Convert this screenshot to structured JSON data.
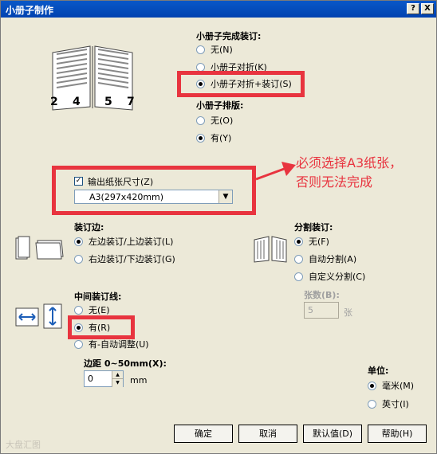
{
  "window": {
    "title": "小册子制作",
    "help_button": "?",
    "close_button": "X"
  },
  "finish": {
    "heading": "小册子完成装订:",
    "options": [
      "无(N)",
      "小册子对折(K)",
      "小册子对折+装订(S)"
    ],
    "selected": 2
  },
  "layout": {
    "heading": "小册子排版:",
    "options": [
      "无(O)",
      "有(Y)"
    ],
    "selected": 1
  },
  "booklet_preview": {
    "pages": [
      "2",
      "4",
      "5",
      "7"
    ]
  },
  "annotation": {
    "line1": "必须选择A3纸张，",
    "line2": "否则无法完成"
  },
  "output_paper": {
    "checkbox_label": "输出纸张尺寸(Z)",
    "checked": true,
    "value": "A3(297x420mm)"
  },
  "binding_edge": {
    "heading": "装订边:",
    "options": [
      "左边装订/上边装订(L)",
      "右边装订/下边装订(G)"
    ],
    "selected": 0
  },
  "split_binding": {
    "heading": "分割装订:",
    "options": [
      "无(F)",
      "自动分割(A)",
      "自定义分割(C)"
    ],
    "selected": 0,
    "sheets_label": "张数(B):",
    "sheets_value": "5",
    "sheets_unit": "张"
  },
  "center_line": {
    "heading": "中间装订线:",
    "options": [
      "无(E)",
      "有(R)",
      "有-自动调整(U)"
    ],
    "selected": 1
  },
  "margin": {
    "label": "边距 0~50mm(X):",
    "value": "0",
    "unit": "mm"
  },
  "unit": {
    "heading": "单位:",
    "options": [
      "毫米(M)",
      "英寸(I)"
    ],
    "selected": 0
  },
  "buttons": {
    "ok": "确定",
    "cancel": "取消",
    "default": "默认值(D)",
    "help": "帮助(H)"
  },
  "watermark": "大盘汇图"
}
